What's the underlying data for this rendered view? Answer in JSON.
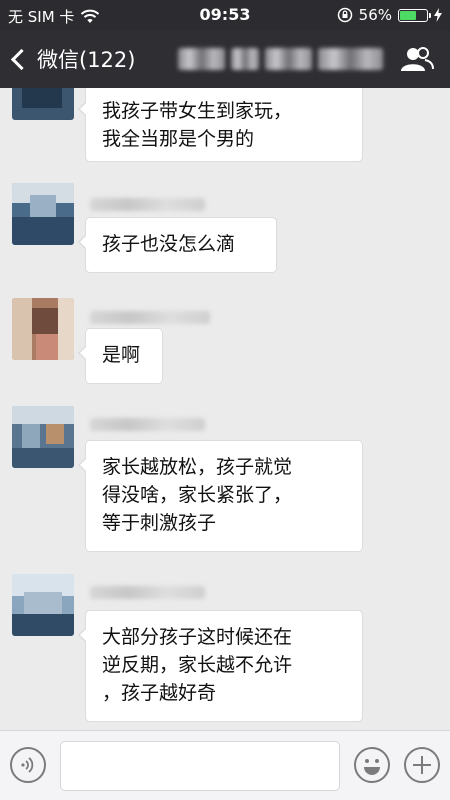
{
  "status_bar": {
    "carrier": "无 SIM 卡",
    "time": "09:53",
    "battery": "56%",
    "battery_level": 0.56
  },
  "nav": {
    "back_label": "微信(122)"
  },
  "messages": [
    {
      "lines": [
        "我孩子带女生到家玩，",
        "我全当那是个男的"
      ]
    },
    {
      "lines": [
        "孩子也没怎么滴"
      ]
    },
    {
      "lines": [
        "是啊"
      ]
    },
    {
      "lines": [
        "家长越放松，孩子就觉",
        "得没啥，家长紧张了，",
        "等于刺激孩子"
      ]
    },
    {
      "lines": [
        "大部分孩子这时候还在",
        "逆反期，家长越不允许",
        "，孩子越好奇"
      ]
    }
  ],
  "input_bar": {
    "placeholder": ""
  },
  "icons": {
    "signal": "wifi-icon",
    "rotation_lock": "rotation-lock-icon",
    "charging": "bolt-icon",
    "group": "group-members-icon",
    "voice": "voice-icon",
    "emoji": "emoji-icon",
    "more": "plus-icon"
  },
  "colors": {
    "header_bg": "#2f2f33",
    "chat_bg": "#ebebeb",
    "battery_fill": "#4cd964"
  }
}
